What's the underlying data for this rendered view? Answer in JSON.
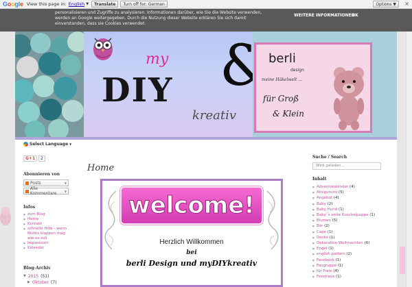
{
  "translate_bar": {
    "logo": "Google",
    "view_text": "View this page in:",
    "language": "English",
    "translate_btn": "Translate",
    "turn_off_btn": "Turn off for: German",
    "options": "Options ▼",
    "close": "×"
  },
  "cookie": {
    "text": "personalisieren und Zugriffe zu analysieren. Informationen darüber, wie Sie die Website verwenden, werden an Google weitergegeben. Durch die Nutzung dieser Website erklären Sie sich damit einverstanden, dass sie Cookies verwendet.",
    "more": "WEITERE INFORMATIONEN",
    "ok": "OK"
  },
  "header": {
    "my": "my",
    "diy": "DIY",
    "kreativ": "kreativ",
    "amp": "&",
    "berli": "berli",
    "design": "design",
    "meine": "meine Häkelwelt ...",
    "fur_gross": "für Groß",
    "und_klein": "& Klein"
  },
  "language_select": "Select Language",
  "gplus": {
    "label": "G+1",
    "count": "2"
  },
  "sidebar": {
    "subscribe_title": "Abonnieren von",
    "feeds": [
      "Posts",
      "Alle Kommentare"
    ],
    "info_title": "Infos",
    "info_links": [
      "zum Blog",
      "Home",
      "Kontakt",
      "schnelle Hilfe - wenn Nichts klappen mag wie es soll",
      "Impressum",
      "Kalender"
    ],
    "archive_title": "Blog-Archiv",
    "archive": [
      {
        "arrow": "▼",
        "label": "2015",
        "count": "(51)"
      },
      {
        "arrow": "▶",
        "label": "Oktober",
        "count": "(7)"
      }
    ]
  },
  "main": {
    "title": "Home",
    "welcome": "welcome!",
    "herzlich": "Herzlich Willkommen",
    "bei": "bei",
    "berli_my": "berli Design und myDIYkreativ"
  },
  "rside": {
    "search_title": "Suche / Search",
    "search_placeholder": "Wird geladen...",
    "labels_title": "Inhalt",
    "labels": [
      {
        "name": "Adventskalender",
        "count": "(4)"
      },
      {
        "name": "Amigurumi",
        "count": "(5)"
      },
      {
        "name": "Angebot",
        "count": "(4)"
      },
      {
        "name": "Baby",
        "count": "(2)"
      },
      {
        "name": "Baby Hund",
        "count": "(1)"
      },
      {
        "name": "Baby´s erste Kuschelpuppe",
        "count": "(1)"
      },
      {
        "name": "Blumen",
        "count": "(5)"
      },
      {
        "name": "Bär",
        "count": "(2)"
      },
      {
        "name": "Cape",
        "count": "(1)"
      },
      {
        "name": "Decke",
        "count": "(1)"
      },
      {
        "name": "Dekoration Weihnachten",
        "count": "(6)"
      },
      {
        "name": "Engel",
        "count": "(1)"
      },
      {
        "name": "english pattern",
        "count": "(2)"
      },
      {
        "name": "Facebook",
        "count": "(1)"
      },
      {
        "name": "Fangruppe",
        "count": "(1)"
      },
      {
        "name": "für Freie",
        "count": "(4)"
      },
      {
        "name": "Feenhaus",
        "count": "(1)"
      }
    ]
  },
  "colors": {
    "accent_pink": "#d04aa0",
    "lavender": "#b1a6db",
    "frame_purple": "#aa7cc6"
  }
}
